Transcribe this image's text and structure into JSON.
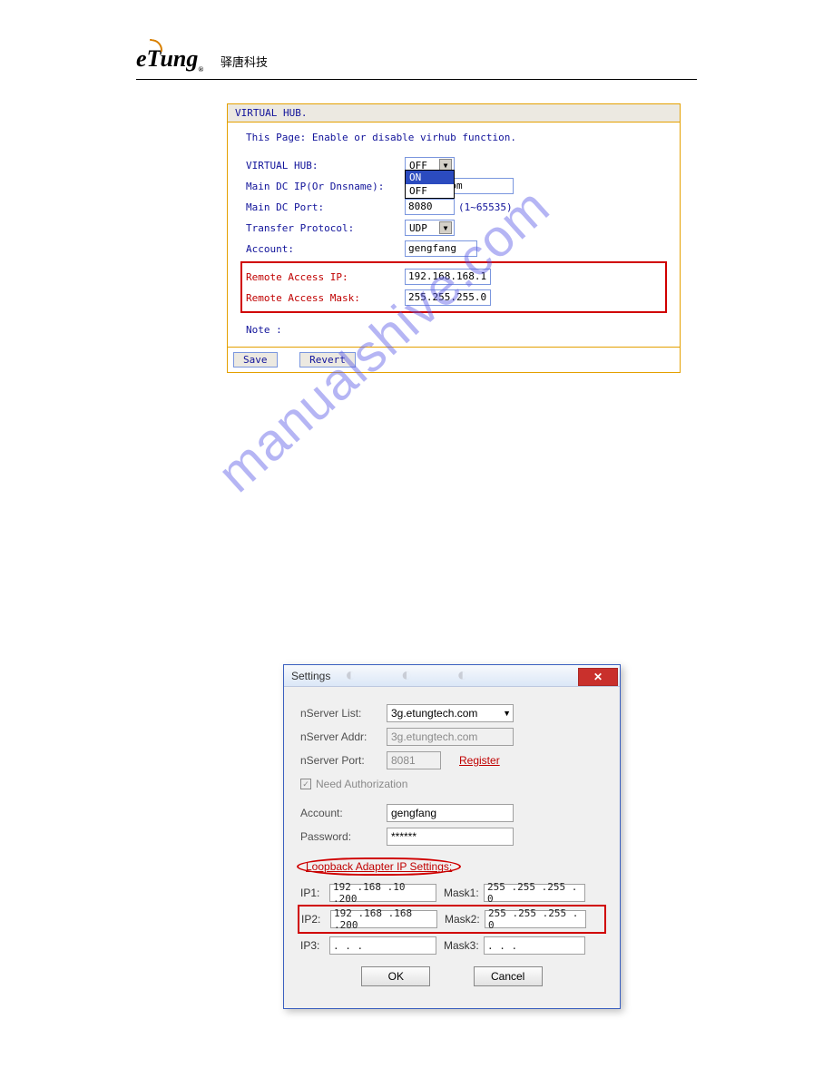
{
  "header": {
    "logo_text": "eTung",
    "logo_sub": "®",
    "logo_cn": "驿唐科技"
  },
  "watermark": "manualshive.com",
  "panel1": {
    "title": "VIRTUAL HUB.",
    "desc": "This Page: Enable or disable virhub function.",
    "rows": {
      "vhub_label": "VIRTUAL HUB:",
      "vhub_value": "OFF",
      "dropdown_on": "ON",
      "dropdown_off": "OFF",
      "maindcip_label": "Main DC IP(Or Dnsname):",
      "maindcip_value": "gtech.com",
      "maindcport_label": "Main DC Port:",
      "maindcport_value": "8080",
      "maindcport_range": "(1~65535)",
      "proto_label": "Transfer Protocol:",
      "proto_value": "UDP",
      "account_label": "Account:",
      "account_value": "gengfang",
      "raip_label": "Remote Access IP:",
      "raip_value": "192.168.168.1",
      "ramask_label": "Remote Access Mask:",
      "ramask_value": "255.255.255.0",
      "note_label": "Note :"
    },
    "buttons": {
      "save": "Save",
      "revert": "Revert"
    }
  },
  "dialog": {
    "title": "Settings",
    "server_list_label": "nServer List:",
    "server_list_value": "3g.etungtech.com",
    "server_addr_label": "nServer Addr:",
    "server_addr_value": "3g.etungtech.com",
    "server_port_label": "nServer Port:",
    "server_port_value": "8081",
    "register": "Register",
    "need_auth": "Need Authorization",
    "account_label": "Account:",
    "account_value": "gengfang",
    "password_label": "Password:",
    "password_value": "******",
    "section": "Loopback Adapter IP Settings:",
    "ip1_label": "IP1:",
    "ip1_value": "192 .168 .10 .200",
    "mask1_label": "Mask1:",
    "mask1_value": "255 .255 .255 . 0",
    "ip2_label": "IP2:",
    "ip2_value": "192 .168 .168 .200",
    "mask2_label": "Mask2:",
    "mask2_value": "255 .255 .255 . 0",
    "ip3_label": "IP3:",
    "ip3_value": " .   .   .  ",
    "mask3_label": "Mask3:",
    "mask3_value": " .   .   .  ",
    "ok": "OK",
    "cancel": "Cancel"
  }
}
